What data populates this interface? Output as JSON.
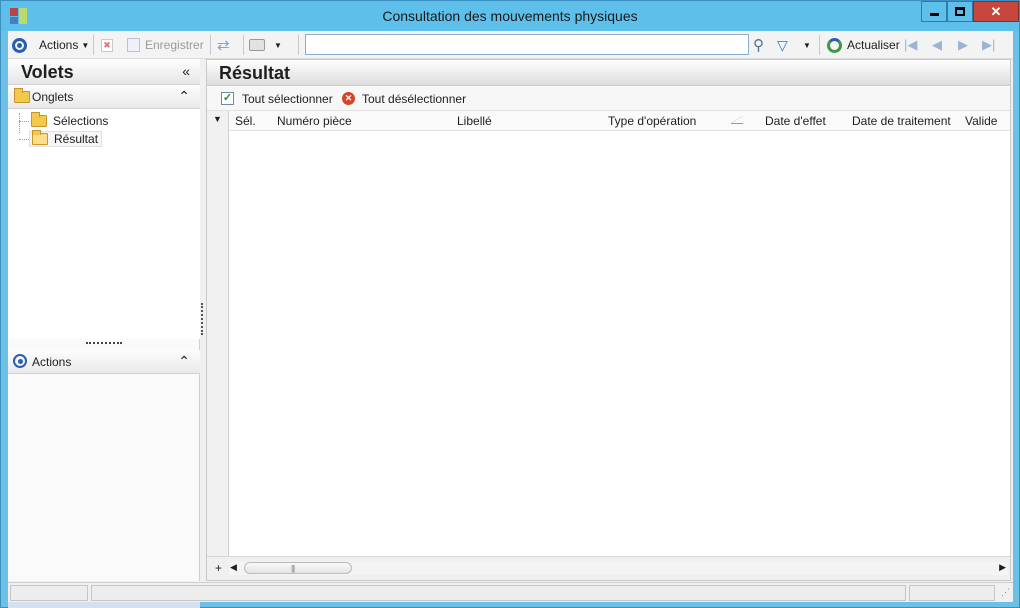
{
  "window": {
    "title": "Consultation des mouvements physiques",
    "close_glyph": "✕"
  },
  "toolbar": {
    "actions_label": "Actions",
    "save_label": "Enregistrer",
    "search_value": "",
    "refresh_label": "Actualiser",
    "nav_icons": [
      "first-record-icon",
      "previous-record-icon",
      "next-record-icon",
      "last-record-icon"
    ]
  },
  "left_panel": {
    "title": "Volets",
    "collapse_glyph": "«",
    "section_title": "Onglets",
    "section_glyph": "⌃",
    "tree_items": [
      {
        "label": "Sélections",
        "state": "closed"
      },
      {
        "label": "Résultat",
        "state": "open",
        "selected": true
      }
    ],
    "actions_title": "Actions",
    "footer_glyph": "▾"
  },
  "result": {
    "title": "Résultat",
    "select_all": "Tout sélectionner",
    "deselect_all": "Tout désélectionner",
    "columns": [
      "Sél.",
      "Numéro pièce",
      "Libellé",
      "Type d'opération",
      "Date d'effet",
      "Date de traitement",
      "Valide"
    ],
    "rows": []
  },
  "colors": {
    "titlebar": "#5ec0ea",
    "close_button": "#c7463e",
    "accent_blue": "#2a5fae",
    "footer_tint": "#d2e0ef"
  }
}
